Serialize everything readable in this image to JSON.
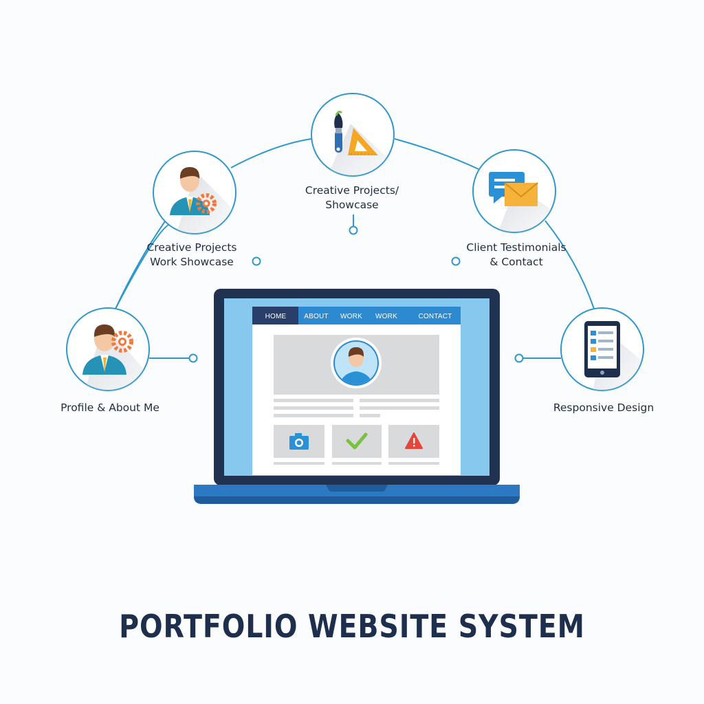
{
  "title": "PORTFOLIO WEBSITE SYSTEM",
  "features": {
    "profile": "Profile & About Me",
    "work": [
      "Creative Projects",
      "Work Showcase"
    ],
    "creative": [
      "Creative Projects/",
      "Showcase"
    ],
    "testimonials": [
      "Client Testimonials",
      "& Contact"
    ],
    "responsive": "Responsive Design"
  },
  "website_nav": [
    "HOME",
    "ABOUT",
    "WORK",
    "WORK",
    "CONTACT"
  ],
  "icons": {
    "profile": "person-gear-icon",
    "work": "person-gear-icon",
    "creative": "brush-ruler-icon",
    "testimonials": "chat-mail-icon",
    "responsive": "tablet-icon",
    "tiles": [
      "camera-icon",
      "checkmark-icon",
      "warning-icon"
    ]
  },
  "colors": {
    "accent": "#2f97c9",
    "navy": "#1e2f4d",
    "laptop": "#203250",
    "screen": "#86c8ee",
    "nav_bar": "#2d8ad1",
    "nav_active": "#2a3e6b"
  }
}
